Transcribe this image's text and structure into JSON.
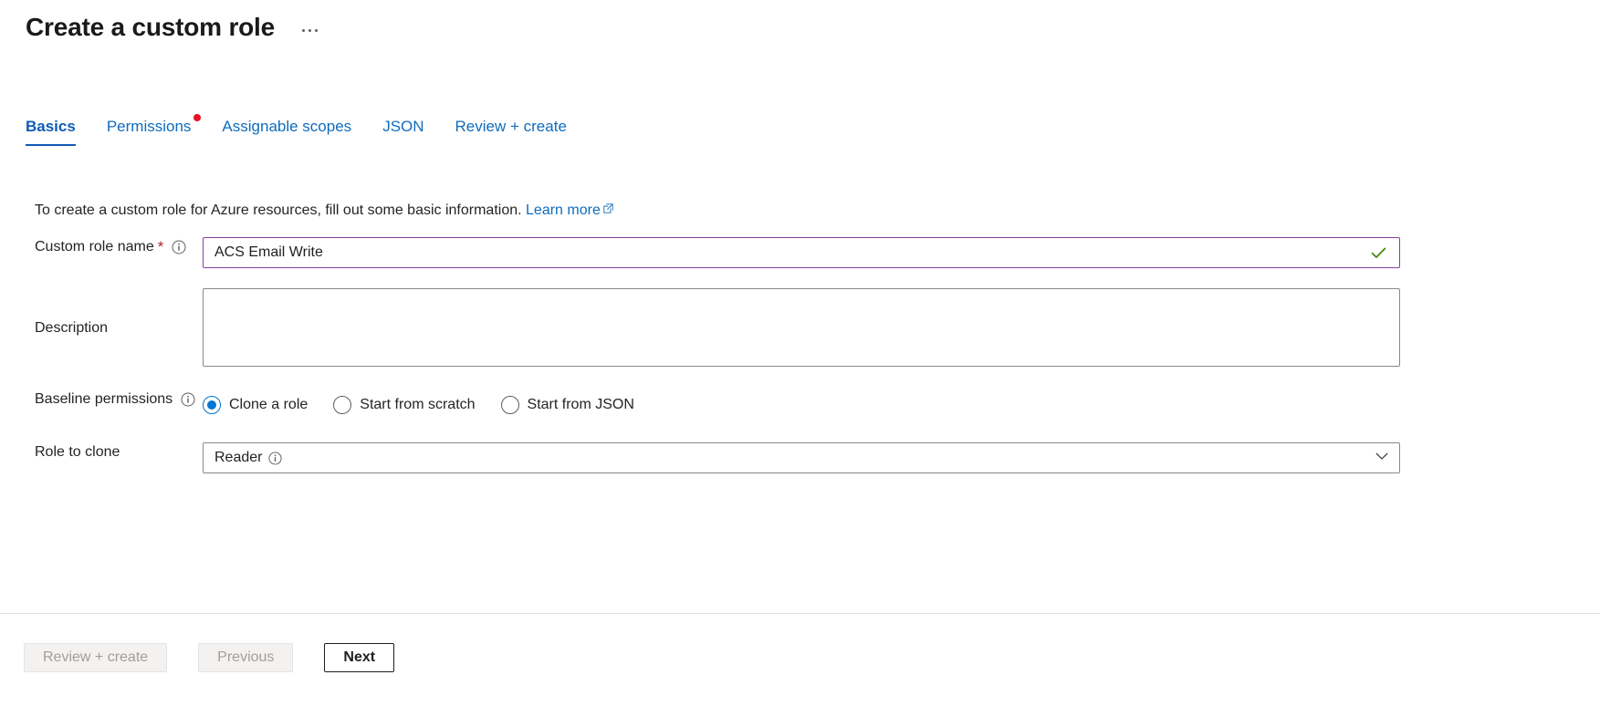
{
  "header": {
    "title": "Create a custom role",
    "more_menu": "more-options"
  },
  "tabs": [
    {
      "label": "Basics",
      "active": true,
      "dot": false
    },
    {
      "label": "Permissions",
      "active": false,
      "dot": true
    },
    {
      "label": "Assignable scopes",
      "active": false,
      "dot": false
    },
    {
      "label": "JSON",
      "active": false,
      "dot": false
    },
    {
      "label": "Review + create",
      "active": false,
      "dot": false
    }
  ],
  "intro": {
    "text": "To create a custom role for Azure resources, fill out some basic information.",
    "link_label": "Learn more",
    "link_icon": "external-link-icon"
  },
  "form": {
    "role_name": {
      "label": "Custom role name",
      "required_marker": "*",
      "info_icon": "info-icon",
      "value": "ACS Email Write",
      "placeholder": "",
      "valid_icon": "checkmark-icon",
      "border_color": "#8a3ea0",
      "valid_color": "#498205"
    },
    "description": {
      "label": "Description",
      "value": "",
      "placeholder": ""
    },
    "baseline_permissions": {
      "label": "Baseline permissions",
      "info_icon": "info-icon",
      "options": [
        {
          "label": "Clone a role",
          "selected": true
        },
        {
          "label": "Start from scratch",
          "selected": false
        },
        {
          "label": "Start from JSON",
          "selected": false
        }
      ],
      "selected_color": "#0078d4"
    },
    "role_to_clone": {
      "label": "Role to clone",
      "value": "Reader",
      "value_info_icon": "info-icon",
      "chevron_icon": "chevron-down-icon"
    }
  },
  "footer": {
    "review_create_label": "Review + create",
    "previous_label": "Previous",
    "next_label": "Next"
  },
  "colors": {
    "link": "#0f6cbd",
    "tab_active": "#0f5bb5",
    "required_star": "#a4262c",
    "notification_dot": "#e81123"
  }
}
